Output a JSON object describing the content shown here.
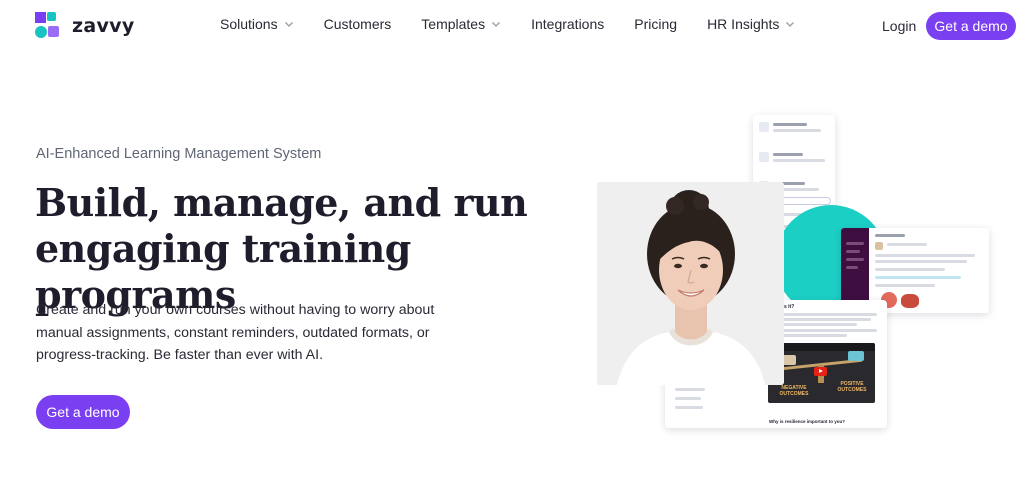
{
  "brand": {
    "name": "zavvy"
  },
  "nav": {
    "items": [
      {
        "label": "Solutions",
        "has_dropdown": true
      },
      {
        "label": "Customers",
        "has_dropdown": false
      },
      {
        "label": "Templates",
        "has_dropdown": true
      },
      {
        "label": "Integrations",
        "has_dropdown": false
      },
      {
        "label": "Pricing",
        "has_dropdown": false
      },
      {
        "label": "HR Insights",
        "has_dropdown": true
      }
    ],
    "login_label": "Login",
    "demo_label": "Get a demo"
  },
  "hero": {
    "eyebrow": "AI-Enhanced Learning Management System",
    "headline_line1": "Build, manage, and run",
    "headline_line2": "engaging training programs",
    "sub_line1": "Create and run your own courses without having to worry about",
    "sub_line2": "manual assignments, constant reminders, outdated formats, or",
    "sub_line3": "progress-tracking. Be faster than ever with AI.",
    "cta_label": "Get a demo"
  },
  "collage": {
    "video_left_label": "NEGATIVE OUTCOMES",
    "video_right_label": "POSITIVE OUTCOMES",
    "article_heading": "What is it?",
    "article_footer": "Why is resilience important to you?"
  },
  "colors": {
    "brand_purple": "#7b3ff2",
    "brand_teal": "#17c3c3",
    "text_dark": "#1f1d2b",
    "text_muted": "#5f6675"
  },
  "icons": {
    "dropdown": "chevron-down-icon",
    "play": "play-icon"
  }
}
